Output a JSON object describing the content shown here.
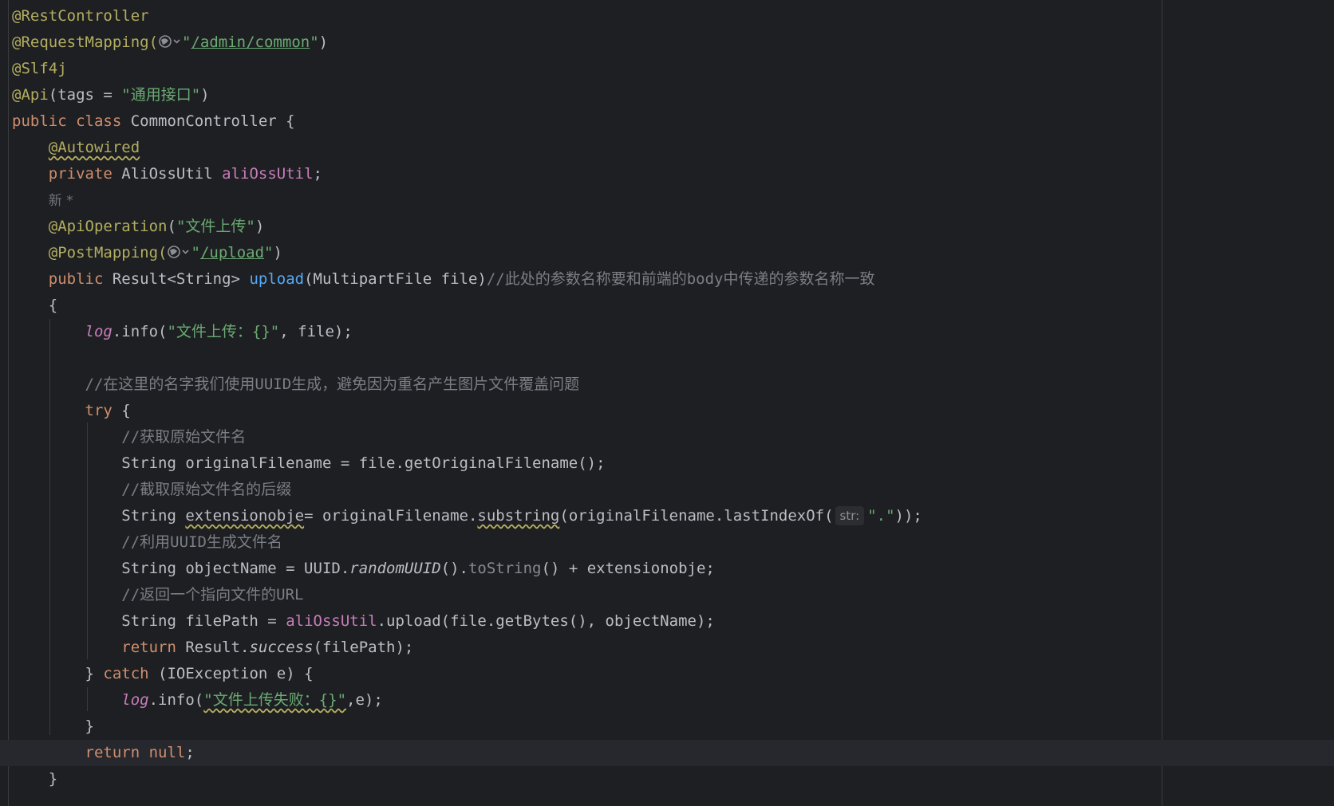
{
  "colors": {
    "background": "#1e1f22",
    "annotation": "#b3ae60",
    "keyword": "#cf8e6d",
    "string": "#6aab73",
    "comment": "#7a7e85",
    "field": "#c77dbb",
    "method": "#56a8f5"
  },
  "code": {
    "l1_ann": "@RestController",
    "l2_ann": "@RequestMapping(",
    "l2_str_open": "\"",
    "l2_path": "/admin/common",
    "l2_str_close": "\"",
    "l2_end": ")",
    "l3_ann": "@Slf4j",
    "l4_ann": "@Api",
    "l4_mid": "(tags = ",
    "l4_str": "\"通用接口\"",
    "l4_end": ")",
    "l5_kw": "public class ",
    "l5_name": "CommonController {",
    "l6_ann": "@Autowired",
    "l7_kw": "private ",
    "l7_type": "AliOssUtil ",
    "l7_field": "aliOssUtil",
    "l7_end": ";",
    "l8_author": "新 *",
    "l9_ann": "@ApiOperation",
    "l9_open": "(",
    "l9_str": "\"文件上传\"",
    "l9_end": ")",
    "l10_ann": "@PostMapping(",
    "l10_str_open": "\"",
    "l10_path": "/upload",
    "l10_str_close": "\"",
    "l10_end": ")",
    "l11_kw": "public ",
    "l11_type": "Result<String> ",
    "l11_fn": "upload",
    "l11_params": "(MultipartFile file)",
    "l11_cmt": "//此处的参数名称要和前端的body中传递的参数名称一致",
    "l12": "{",
    "l13_log": "log",
    "l13_mid": ".info(",
    "l13_str": "\"文件上传：{}\"",
    "l13_end": ", file);",
    "l15_cmt": "//在这里的名字我们使用UUID生成，避免因为重名产生图片文件覆盖问题",
    "l16_kw": "try",
    "l16_end": " {",
    "l17_cmt": "//获取原始文件名",
    "l18": "String originalFilename = file.getOriginalFilename();",
    "l19_cmt": "//截取原始文件名的后缀",
    "l20_a": "String ",
    "l20_var": "extensionobje",
    "l20_b": "= originalFilename.",
    "l20_sub": "substring",
    "l20_c": "(originalFilename.lastIndexOf(",
    "l20_hint": "str:",
    "l20_str": "\".\"",
    "l20_end": "));",
    "l21_cmt": "//利用UUID生成文件名",
    "l22_a": "String objectName = UUID.",
    "l22_static": "randomUUID",
    "l22_b": "().",
    "l22_tostr": "toString",
    "l22_c": "() + extensionobje;",
    "l23_cmt": "//返回一个指向文件的URL",
    "l24_a": "String filePath = ",
    "l24_field": "aliOssUtil",
    "l24_b": ".upload(file.getBytes(), objectName);",
    "l25_kw": "return ",
    "l25_a": "Result.",
    "l25_static": "success",
    "l25_b": "(filePath);",
    "l26_a": "} ",
    "l26_kw": "catch",
    "l26_b": " (IOException e) {",
    "l27_log": "log",
    "l27_mid": ".info(",
    "l27_str": "\"文件上传失败：{}\"",
    "l27_end": ",e);",
    "l28": "}",
    "l29_kw": "return null",
    "l29_end": ";",
    "l30": "}"
  }
}
